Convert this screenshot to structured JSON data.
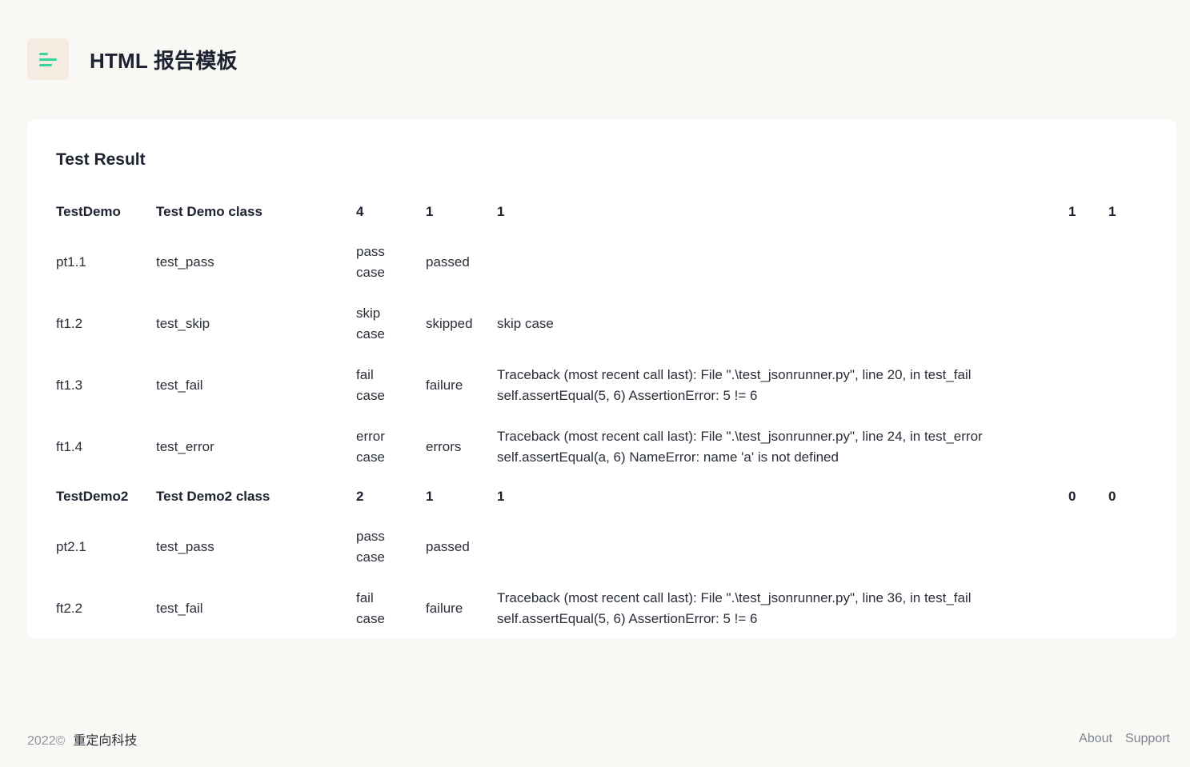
{
  "header": {
    "title": "HTML 报告模板",
    "logo_icon": "menu-lines-icon",
    "logo_color": "#38d39f",
    "logo_bg": "#f5ebe1"
  },
  "card": {
    "title": "Test Result",
    "groups": [
      {
        "name": "TestDemo",
        "description": "Test Demo class",
        "count": "4",
        "pass": "1",
        "fail": "1",
        "error": "1",
        "skip": "1",
        "cases": [
          {
            "id": "pt1.1",
            "name": "test_pass",
            "desc_line1": "pass",
            "desc_line2": "case",
            "status": "passed",
            "msg_line1": "",
            "msg_line2": ""
          },
          {
            "id": "ft1.2",
            "name": "test_skip",
            "desc_line1": "skip",
            "desc_line2": "case",
            "status": "skipped",
            "msg_line1": "skip case",
            "msg_line2": ""
          },
          {
            "id": "ft1.3",
            "name": "test_fail",
            "desc_line1": "fail",
            "desc_line2": "case",
            "status": "failure",
            "msg_line1": "Traceback (most recent call last): File \".\\test_jsonrunner.py\", line 20, in test_fail",
            "msg_line2": "self.assertEqual(5, 6) AssertionError: 5 != 6"
          },
          {
            "id": "ft1.4",
            "name": "test_error",
            "desc_line1": "error",
            "desc_line2": "case",
            "status": "errors",
            "msg_line1": "Traceback (most recent call last): File \".\\test_jsonrunner.py\", line 24, in test_error",
            "msg_line2": "self.assertEqual(a, 6) NameError: name 'a' is not defined"
          }
        ]
      },
      {
        "name": "TestDemo2",
        "description": "Test Demo2 class",
        "count": "2",
        "pass": "1",
        "fail": "1",
        "error": "0",
        "skip": "0",
        "cases": [
          {
            "id": "pt2.1",
            "name": "test_pass",
            "desc_line1": "pass",
            "desc_line2": "case",
            "status": "passed",
            "msg_line1": "",
            "msg_line2": ""
          },
          {
            "id": "ft2.2",
            "name": "test_fail",
            "desc_line1": "fail",
            "desc_line2": "case",
            "status": "failure",
            "msg_line1": "Traceback (most recent call last): File \".\\test_jsonrunner.py\", line 36, in test_fail",
            "msg_line2": "self.assertEqual(5, 6) AssertionError: 5 != 6"
          }
        ]
      }
    ]
  },
  "footer": {
    "year": "2022©",
    "company": "重定向科技",
    "about": "About",
    "support": "Support"
  }
}
